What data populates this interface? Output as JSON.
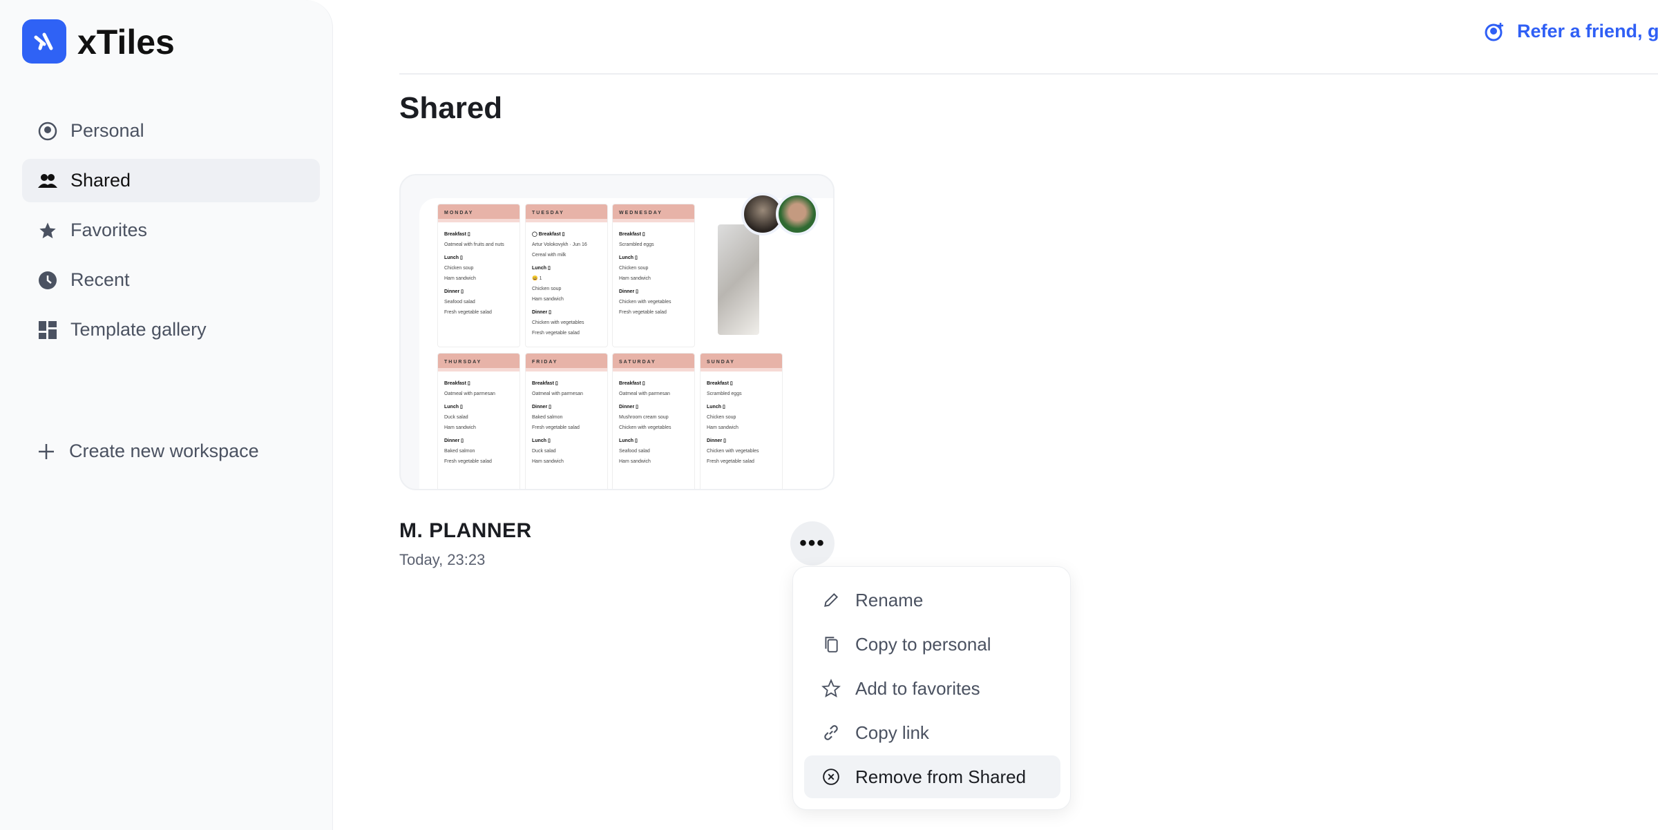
{
  "app": {
    "name": "xTiles"
  },
  "sidebar": {
    "items": [
      {
        "label": "Personal",
        "icon": "user-circle-icon"
      },
      {
        "label": "Shared",
        "icon": "users-icon",
        "active": true
      },
      {
        "label": "Favorites",
        "icon": "star-icon"
      },
      {
        "label": "Recent",
        "icon": "clock-icon"
      },
      {
        "label": "Template gallery",
        "icon": "grid-icon"
      }
    ],
    "create": "Create new workspace"
  },
  "header": {
    "refer": "Refer a friend, ge"
  },
  "page": {
    "title": "Shared"
  },
  "document": {
    "name": "M. PLANNER",
    "date": "Today, 23:23",
    "thumbnail": {
      "columns": [
        {
          "day": "MONDAY",
          "lines": [
            [
              "b",
              "Breakfast ▯"
            ],
            [
              "t",
              "Oatmeal with fruits and nuts"
            ],
            [
              "b",
              "Lunch ▯"
            ],
            [
              "t",
              "Chicken soup"
            ],
            [
              "t",
              "Ham sandwich"
            ],
            [
              "b",
              "Dinner ▯"
            ],
            [
              "t",
              "Seafood salad"
            ],
            [
              "t",
              "Fresh vegetable salad"
            ]
          ]
        },
        {
          "day": "TUESDAY",
          "lines": [
            [
              "b",
              "◯ Breakfast ▯"
            ],
            [
              "t",
              "Artur Volokovykh · Jun 16"
            ],
            [
              "t",
              "Cereal with milk"
            ],
            [
              "b",
              "Lunch ▯"
            ],
            [
              "t",
              "😀 1"
            ],
            [
              "t",
              "Chicken soup"
            ],
            [
              "t",
              "Ham sandwich"
            ],
            [
              "b",
              "Dinner ▯"
            ],
            [
              "t",
              "Chicken with vegetables"
            ],
            [
              "t",
              "Fresh vegetable salad"
            ]
          ]
        },
        {
          "day": "WEDNESDAY",
          "lines": [
            [
              "b",
              "Breakfast ▯"
            ],
            [
              "t",
              "Scrambled eggs"
            ],
            [
              "b",
              "Lunch ▯"
            ],
            [
              "t",
              "Chicken soup"
            ],
            [
              "t",
              "Ham sandwich"
            ],
            [
              "b",
              "Dinner ▯"
            ],
            [
              "t",
              "Chicken with vegetables"
            ],
            [
              "t",
              "Fresh vegetable salad"
            ]
          ]
        },
        {
          "day": "THURSDAY",
          "lines": [
            [
              "b",
              "Breakfast ▯"
            ],
            [
              "t",
              "Oatmeal with parmesan"
            ],
            [
              "b",
              "Lunch ▯"
            ],
            [
              "t",
              "Duck salad"
            ],
            [
              "t",
              "Ham sandwich"
            ],
            [
              "b",
              "Dinner ▯"
            ],
            [
              "t",
              "Baked salmon"
            ],
            [
              "t",
              "Fresh vegetable salad"
            ]
          ]
        },
        {
          "day": "FRIDAY",
          "lines": [
            [
              "b",
              "Breakfast ▯"
            ],
            [
              "t",
              "Oatmeal with parmesan"
            ],
            [
              "b",
              "Dinner ▯"
            ],
            [
              "t",
              "Baked salmon"
            ],
            [
              "t",
              "Fresh vegetable salad"
            ],
            [
              "b",
              "Lunch ▯"
            ],
            [
              "t",
              "Duck salad"
            ],
            [
              "t",
              "Ham sandwich"
            ]
          ]
        },
        {
          "day": "SATURDAY",
          "lines": [
            [
              "b",
              "Breakfast ▯"
            ],
            [
              "t",
              "Oatmeal with parmesan"
            ],
            [
              "b",
              "Dinner ▯"
            ],
            [
              "t",
              "Mushroom cream soup"
            ],
            [
              "t",
              "Chicken with vegetables"
            ],
            [
              "b",
              "Lunch ▯"
            ],
            [
              "t",
              "Seafood salad"
            ],
            [
              "t",
              "Ham sandwich"
            ]
          ]
        },
        {
          "day": "SUNDAY",
          "lines": [
            [
              "b",
              "Breakfast ▯"
            ],
            [
              "t",
              "Scrambled eggs"
            ],
            [
              "b",
              "Lunch ▯"
            ],
            [
              "t",
              "Chicken soup"
            ],
            [
              "t",
              "Ham sandwich"
            ],
            [
              "b",
              "Dinner ▯"
            ],
            [
              "t",
              "Chicken with vegetables"
            ],
            [
              "t",
              "Fresh vegetable salad"
            ]
          ]
        }
      ]
    }
  },
  "context_menu": {
    "items": [
      {
        "label": "Rename",
        "icon": "pencil-icon"
      },
      {
        "label": "Copy to personal",
        "icon": "copy-icon"
      },
      {
        "label": "Add to favorites",
        "icon": "star-outline-icon"
      },
      {
        "label": "Copy link",
        "icon": "link-icon"
      },
      {
        "label": "Remove from Shared",
        "icon": "x-circle-icon",
        "highlighted": true
      }
    ]
  },
  "colors": {
    "accent": "#2f5ff5",
    "day_header": "#e7b3a8"
  }
}
